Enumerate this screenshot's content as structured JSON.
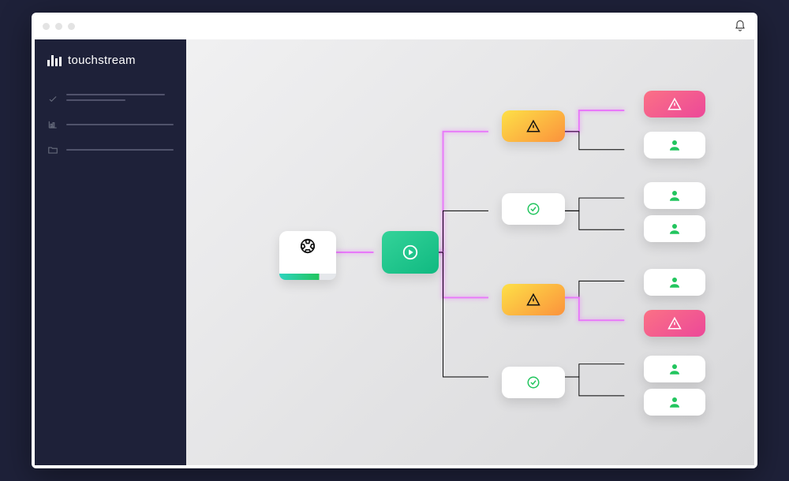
{
  "brand": {
    "name": "touchstream"
  },
  "sidebar": {
    "items": [
      {
        "icon": "check"
      },
      {
        "icon": "chart"
      },
      {
        "icon": "folder"
      }
    ]
  },
  "diagram": {
    "source": {
      "icon": "soccer",
      "status": "ok",
      "progress": 0.7
    },
    "encoder": {
      "icon": "play",
      "status": "ok"
    },
    "streams": [
      {
        "icon": "warning",
        "status": "warn",
        "endpoints": [
          {
            "icon": "warning",
            "status": "error"
          },
          {
            "icon": "user",
            "status": "ok"
          }
        ]
      },
      {
        "icon": "check-circle",
        "status": "ok",
        "endpoints": [
          {
            "icon": "user",
            "status": "ok"
          },
          {
            "icon": "user",
            "status": "ok"
          }
        ]
      },
      {
        "icon": "warning",
        "status": "warn",
        "endpoints": [
          {
            "icon": "user",
            "status": "ok"
          },
          {
            "icon": "warning",
            "status": "error"
          }
        ]
      },
      {
        "icon": "check-circle",
        "status": "ok",
        "endpoints": [
          {
            "icon": "user",
            "status": "ok"
          },
          {
            "icon": "user",
            "status": "ok"
          }
        ]
      }
    ]
  },
  "colors": {
    "ok": "#22c55e",
    "warn": "#f59e0b",
    "error": "#ec4899",
    "bg": "#1e2139"
  }
}
